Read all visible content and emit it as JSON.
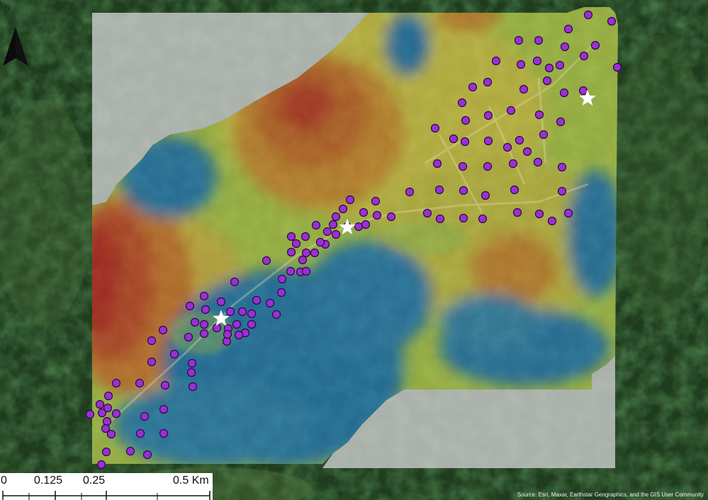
{
  "map": {
    "colors": {
      "background_forest": "#1d3a1c",
      "no_data": "#c8c8c8",
      "low": "#2e7db3",
      "mid_low": "#8cbf5a",
      "mid": "#d8c84a",
      "mid_high": "#d9902f",
      "high": "#c8352a",
      "sample_point": "#9b2fd6",
      "sample_stroke": "#2b0a3d",
      "star": "#ffffff"
    },
    "legend_north": {
      "label": "N",
      "icon": "north-arrow-icon"
    },
    "scale_bar": {
      "labels": [
        "0",
        "0.125",
        "0.25",
        "0.5 Km"
      ]
    },
    "attribution": "Source: Esri, Maxar, Earthstar Geographics, and the GIS User Community",
    "sample_point_count": 162,
    "star_marker_count": 3
  }
}
